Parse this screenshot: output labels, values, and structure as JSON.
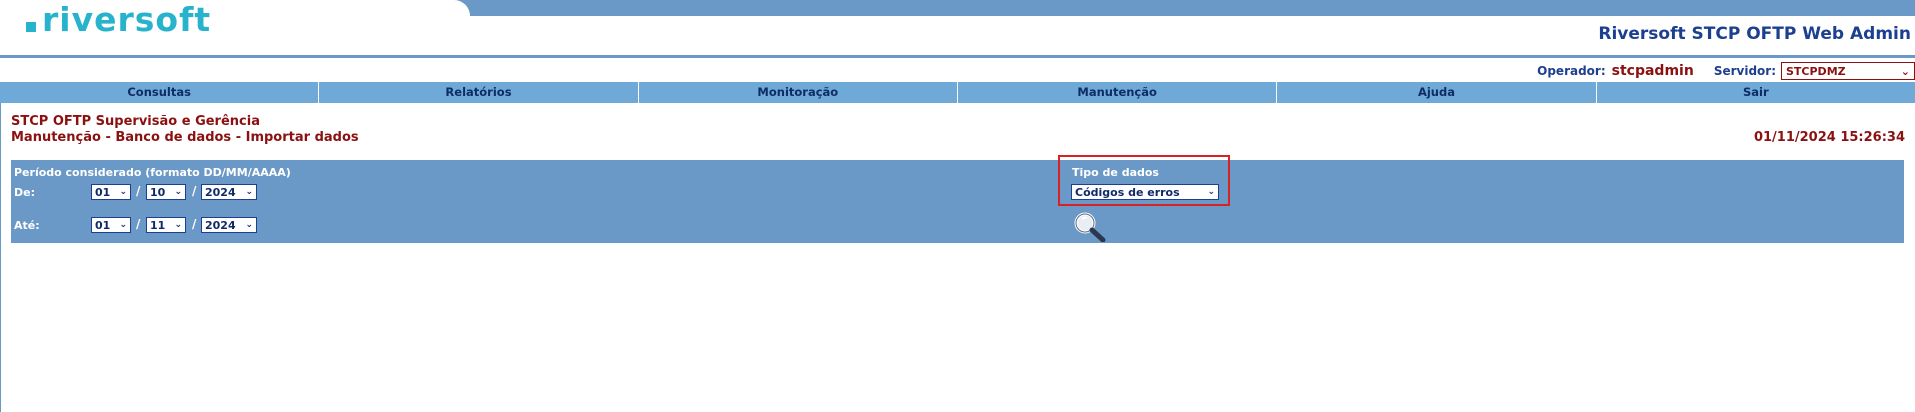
{
  "header": {
    "logo_text": "riversoft",
    "app_title": "Riversoft STCP OFTP Web Admin"
  },
  "session": {
    "operator_label": "Operador:",
    "operator_value": "stcpadmin",
    "server_label": "Servidor:",
    "server_value": "STCPDMZ"
  },
  "nav": {
    "items": [
      {
        "label": "Consultas"
      },
      {
        "label": "Relatórios"
      },
      {
        "label": "Monitoração"
      },
      {
        "label": "Manutenção"
      },
      {
        "label": "Ajuda"
      },
      {
        "label": "Sair"
      }
    ]
  },
  "page": {
    "title_line1": "STCP OFTP Supervisão e Gerência",
    "title_line2": "Manutenção - Banco de dados - Importar dados",
    "datetime": "01/11/2024 15:26:34"
  },
  "form": {
    "period_label": "Período considerado (formato DD/MM/AAAA)",
    "from_label": "De:",
    "to_label": "Até:",
    "from": {
      "day": "01",
      "month": "10",
      "year": "2024"
    },
    "to": {
      "day": "01",
      "month": "11",
      "year": "2024"
    },
    "separator": "/",
    "data_type_label": "Tipo de dados",
    "data_type_value": "Códigos de erros"
  },
  "colors": {
    "brand": "#28b3cc",
    "panel": "#6b99c7",
    "nav": "#6ea9d8",
    "title_text": "#8b1111",
    "highlight": "#d82222"
  },
  "icons": {
    "search": "magnifier-icon",
    "dropdown": "chevron-down-icon"
  }
}
